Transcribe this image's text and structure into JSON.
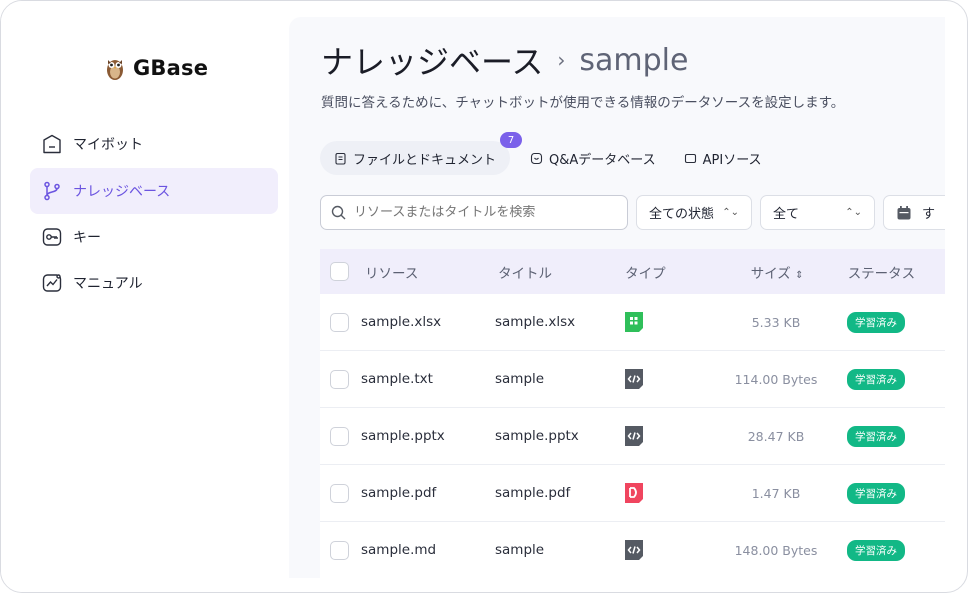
{
  "sidebar": {
    "brand": "GBase",
    "items": [
      {
        "label": "マイボット",
        "icon": "bot-icon"
      },
      {
        "label": "ナレッジベース",
        "icon": "branch-icon"
      },
      {
        "label": "キー",
        "icon": "key-icon"
      },
      {
        "label": "マニュアル",
        "icon": "manual-icon"
      }
    ],
    "active_index": 1
  },
  "header": {
    "title": "ナレッジベース",
    "separator": "›",
    "subtitle": "sample",
    "description": "質問に答えるために、チャットボットが使用できる情報のデータソースを設定します。"
  },
  "tabs": [
    {
      "label": "ファイルとドキュメント",
      "icon": "document-icon",
      "badge": "7"
    },
    {
      "label": "Q&Aデータベース",
      "icon": "qa-icon"
    },
    {
      "label": "APIソース",
      "icon": "api-icon"
    }
  ],
  "filters": {
    "search_placeholder": "リソースまたはタイトルを検索",
    "status_select": "全ての状態",
    "type_select": "全て",
    "date_select": "す"
  },
  "table": {
    "headers": {
      "resource": "リソース",
      "title": "タイトル",
      "type": "タイプ",
      "size": "サイズ",
      "status": "ステータス"
    },
    "rows": [
      {
        "resource": "sample.xlsx",
        "title": "sample.xlsx",
        "type": "spreadsheet",
        "size": "5.33 KB",
        "status": "学習済み"
      },
      {
        "resource": "sample.txt",
        "title": "sample",
        "type": "code",
        "size": "114.00 Bytes",
        "status": "学習済み"
      },
      {
        "resource": "sample.pptx",
        "title": "sample.pptx",
        "type": "code",
        "size": "28.47 KB",
        "status": "学習済み"
      },
      {
        "resource": "sample.pdf",
        "title": "sample.pdf",
        "type": "pdf",
        "size": "1.47 KB",
        "status": "学習済み"
      },
      {
        "resource": "sample.md",
        "title": "sample",
        "type": "code",
        "size": "148.00 Bytes",
        "status": "学習済み"
      }
    ]
  },
  "colors": {
    "accent": "#7b61ea",
    "status_green": "#12b886",
    "spreadsheet": "#2fbf5a",
    "pdf": "#f0455f",
    "code": "#555a63"
  }
}
